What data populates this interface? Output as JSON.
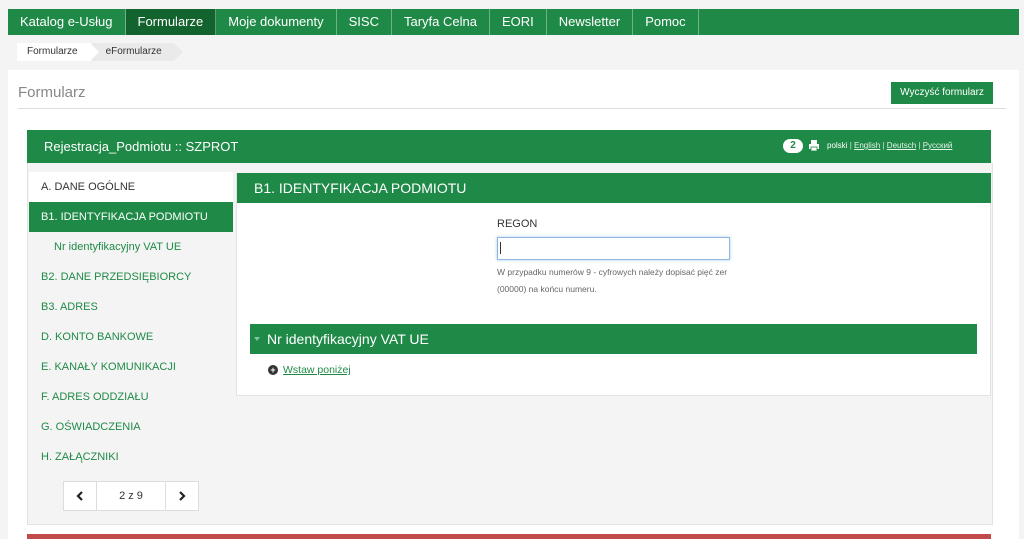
{
  "nav": {
    "tabs": [
      {
        "label": "Katalog e-Usług",
        "active": false
      },
      {
        "label": "Formularze",
        "active": true
      },
      {
        "label": "Moje dokumenty",
        "active": false
      },
      {
        "label": "SISC",
        "active": false
      },
      {
        "label": "Taryfa Celna",
        "active": false
      },
      {
        "label": "EORI",
        "active": false
      },
      {
        "label": "Newsletter",
        "active": false
      },
      {
        "label": "Pomoc",
        "active": false
      }
    ]
  },
  "breadcrumb": [
    "Formularze",
    "eFormularze"
  ],
  "page": {
    "title": "Formularz",
    "clear_button": "Wyczyść formularz"
  },
  "form": {
    "title": "Rejestracja_Podmiotu :: SZPROT",
    "badge_count": "2",
    "languages": [
      {
        "label": "polski",
        "current": true
      },
      {
        "label": "English",
        "current": false
      },
      {
        "label": "Deutsch",
        "current": false
      },
      {
        "label": "Русский",
        "current": false
      }
    ]
  },
  "sidebar": {
    "items": [
      {
        "label": "A. DANE OGÓLNE"
      },
      {
        "label": "B1. IDENTYFIKACJA PODMIOTU"
      },
      {
        "label": "Nr identyfikacyjny VAT UE"
      },
      {
        "label": "B2. DANE PRZEDSIĘBIORCY"
      },
      {
        "label": "B3. ADRES"
      },
      {
        "label": "D. KONTO BANKOWE"
      },
      {
        "label": "E. KANAŁY KOMUNIKACJI"
      },
      {
        "label": "F. ADRES ODDZIAŁU"
      },
      {
        "label": "G. OŚWIADCZENIA"
      },
      {
        "label": "H. ZAŁĄCZNIKI"
      }
    ],
    "pager": "2 z 9"
  },
  "section": {
    "title": "B1. IDENTYFIKACJA PODMIOTU",
    "regon_label": "REGON",
    "regon_value": "",
    "hint": "W przypadku numerów 9 - cyfrowych należy dopisać pięć zer (00000) na końcu numeru.",
    "vat_title": "Nr identyfikacyjny VAT UE",
    "insert_label": "Wstaw poniżej"
  },
  "colors": {
    "accent": "#1f8a47",
    "accent_dark": "#13632f",
    "alert": "#c14b4b"
  }
}
